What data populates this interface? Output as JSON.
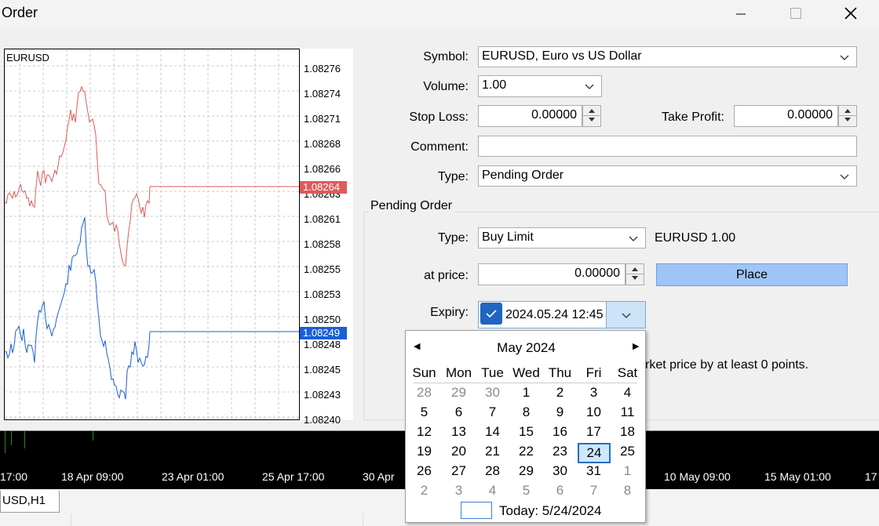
{
  "window": {
    "title": "Order"
  },
  "chart": {
    "symbol": "EURUSD",
    "price_labels": [
      "1.08276",
      "1.08274",
      "1.08271",
      "1.08268",
      "1.08266",
      "1.08263",
      "1.08261",
      "1.08258",
      "1.08255",
      "1.08253",
      "1.08250",
      "1.08248",
      "1.08245",
      "1.08243",
      "1.08240"
    ],
    "ask_tag": "1.08264",
    "bid_tag": "1.08249",
    "ask_color": "#e05a5a",
    "bid_color": "#1a5fd6"
  },
  "form": {
    "symbol_label": "Symbol:",
    "symbol_value": "EURUSD, Euro vs US Dollar",
    "volume_label": "Volume:",
    "volume_value": "1.00",
    "stoploss_label": "Stop Loss:",
    "stoploss_value": "0.00000",
    "takeprofit_label": "Take Profit:",
    "takeprofit_value": "0.00000",
    "comment_label": "Comment:",
    "comment_value": "",
    "type_label": "Type:",
    "type_value": "Pending Order"
  },
  "pending": {
    "group_title": "Pending Order",
    "type_label": "Type:",
    "type_value": "Buy Limit",
    "summary": "EURUSD 1.00",
    "price_label": "at price:",
    "price_value": "0.00000",
    "place_label": "Place",
    "expiry_label": "Expiry:",
    "expiry_value": "2024.05.24 12:45",
    "expiry_checked": true,
    "note": "rket price by at least 0 points."
  },
  "calendar": {
    "month_label": "May 2024",
    "weekdays": [
      "Sun",
      "Mon",
      "Tue",
      "Wed",
      "Thu",
      "Fri",
      "Sat"
    ],
    "weeks": [
      [
        [
          "28",
          true
        ],
        [
          "29",
          true
        ],
        [
          "30",
          true
        ],
        [
          "1",
          false
        ],
        [
          "2",
          false
        ],
        [
          "3",
          false
        ],
        [
          "4",
          false
        ]
      ],
      [
        [
          "5",
          false
        ],
        [
          "6",
          false
        ],
        [
          "7",
          false
        ],
        [
          "8",
          false
        ],
        [
          "9",
          false
        ],
        [
          "10",
          false
        ],
        [
          "11",
          false
        ]
      ],
      [
        [
          "12",
          false
        ],
        [
          "13",
          false
        ],
        [
          "14",
          false
        ],
        [
          "15",
          false
        ],
        [
          "16",
          false
        ],
        [
          "17",
          false
        ],
        [
          "18",
          false
        ]
      ],
      [
        [
          "19",
          false
        ],
        [
          "20",
          false
        ],
        [
          "21",
          false
        ],
        [
          "22",
          false
        ],
        [
          "23",
          false
        ],
        [
          "24",
          false
        ],
        [
          "25",
          false
        ]
      ],
      [
        [
          "26",
          false
        ],
        [
          "27",
          false
        ],
        [
          "28",
          false
        ],
        [
          "29",
          false
        ],
        [
          "30",
          false
        ],
        [
          "31",
          false
        ],
        [
          "1",
          true
        ]
      ],
      [
        [
          "2",
          true
        ],
        [
          "3",
          true
        ],
        [
          "4",
          true
        ],
        [
          "5",
          true
        ],
        [
          "6",
          true
        ],
        [
          "7",
          true
        ],
        [
          "8",
          true
        ]
      ]
    ],
    "selected_day": "24",
    "today_label": "Today: 5/24/2024"
  },
  "background": {
    "time_labels": [
      "17:00",
      "18 Apr 09:00",
      "23 Apr 01:00",
      "25 Apr 17:00",
      "30 Apr",
      "10 May 09:00",
      "15 May 01:00",
      "17"
    ],
    "tab_label": "USD,H1"
  }
}
